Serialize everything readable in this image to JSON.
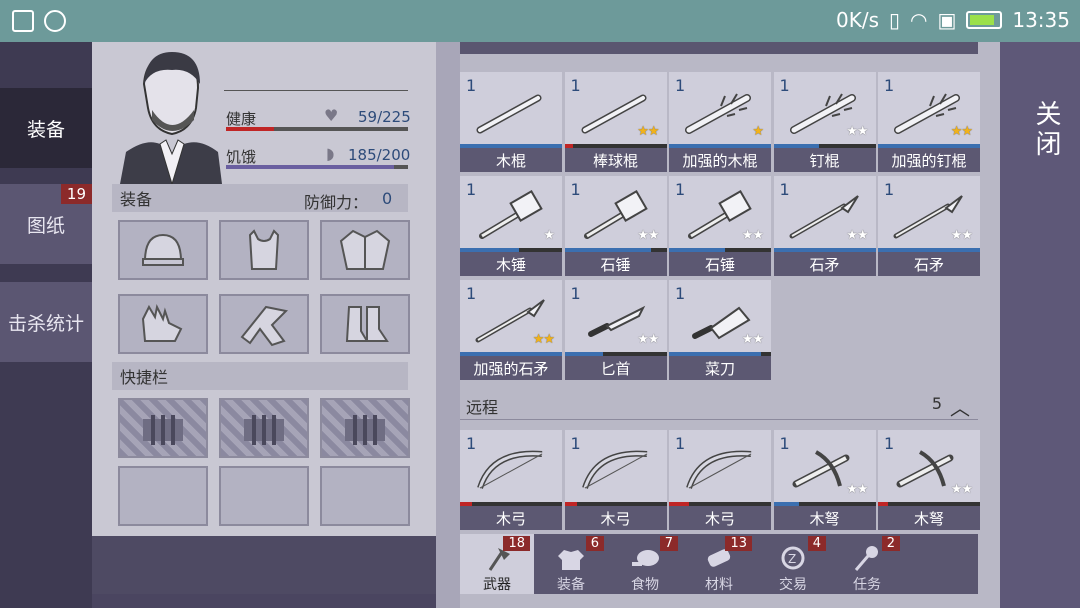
{
  "status_bar": {
    "speed": "0K/s",
    "time": "13:35"
  },
  "left_tabs": [
    {
      "label": "装备",
      "active": true
    },
    {
      "label": "图纸",
      "badge": "19"
    },
    {
      "label": "击杀统计"
    }
  ],
  "character": {
    "health_label": "健康",
    "health_value": "59/225",
    "hunger_label": "饥饿",
    "hunger_value": "185/200",
    "equip_label": "装备",
    "defense_label": "防御力：",
    "defense_value": "0",
    "hotbar_label": "快捷栏",
    "equip_slots": [
      "hat-icon",
      "vest-icon",
      "jacket-icon",
      "gloves-icon",
      "pants-icon",
      "boots-icon"
    ]
  },
  "inventory": {
    "melee": [
      {
        "qty": "1",
        "name": "木棍",
        "stars": "",
        "star_color": "none",
        "bar_color": "#3b6fb0",
        "bar_pct": 100
      },
      {
        "qty": "1",
        "name": "棒球棍",
        "stars": "★★",
        "star_color": "gold",
        "bar_color": "#c02525",
        "bar_pct": 8
      },
      {
        "qty": "1",
        "name": "加强的木棍",
        "stars": "★",
        "star_color": "gold",
        "bar_color": "#3b6fb0",
        "bar_pct": 100
      },
      {
        "qty": "1",
        "name": "钉棍",
        "stars": "★★",
        "star_color": "white",
        "bar_color": "#3b6fb0",
        "bar_pct": 45
      },
      {
        "qty": "1",
        "name": "加强的钉棍",
        "stars": "★★",
        "star_color": "gold",
        "bar_color": "#3b6fb0",
        "bar_pct": 100
      },
      {
        "qty": "1",
        "name": "木锤",
        "stars": "★",
        "star_color": "white",
        "bar_color": "#3b6fb0",
        "bar_pct": 58
      },
      {
        "qty": "1",
        "name": "石锤",
        "stars": "★★",
        "star_color": "white",
        "bar_color": "#3b6fb0",
        "bar_pct": 85
      },
      {
        "qty": "1",
        "name": "石锤",
        "stars": "★★",
        "star_color": "white",
        "bar_color": "#3b6fb0",
        "bar_pct": 55
      },
      {
        "qty": "1",
        "name": "石矛",
        "stars": "★★",
        "star_color": "white",
        "bar_color": "#3b6fb0",
        "bar_pct": 100
      },
      {
        "qty": "1",
        "name": "石矛",
        "stars": "★★",
        "star_color": "white",
        "bar_color": "#3b6fb0",
        "bar_pct": 100
      },
      {
        "qty": "1",
        "name": "加强的石矛",
        "stars": "★★",
        "star_color": "gold",
        "bar_color": "#3b6fb0",
        "bar_pct": 100
      },
      {
        "qty": "1",
        "name": "匕首",
        "stars": "★★",
        "star_color": "white",
        "bar_color": "#3b6fb0",
        "bar_pct": 38
      },
      {
        "qty": "1",
        "name": "菜刀",
        "stars": "★★",
        "star_color": "white",
        "bar_color": "#3b6fb0",
        "bar_pct": 90
      }
    ],
    "ranged_title": "远程",
    "ranged_count": "5",
    "ranged": [
      {
        "qty": "1",
        "name": "木弓",
        "stars": "",
        "star_color": "none",
        "bar_color": "#c02525",
        "bar_pct": 12
      },
      {
        "qty": "1",
        "name": "木弓",
        "stars": "",
        "star_color": "none",
        "bar_color": "#c02525",
        "bar_pct": 12
      },
      {
        "qty": "1",
        "name": "木弓",
        "stars": "",
        "star_color": "none",
        "bar_color": "#c02525",
        "bar_pct": 20
      },
      {
        "qty": "1",
        "name": "木弩",
        "stars": "★★",
        "star_color": "white",
        "bar_color": "#3b6fb0",
        "bar_pct": 25
      },
      {
        "qty": "1",
        "name": "木弩",
        "stars": "★★",
        "star_color": "white",
        "bar_color": "#c02525",
        "bar_pct": 10
      }
    ]
  },
  "categories": [
    {
      "label": "武器",
      "badge": "18",
      "icon": "axe-icon",
      "active": true
    },
    {
      "label": "装备",
      "badge": "6",
      "icon": "shirt-icon"
    },
    {
      "label": "食物",
      "badge": "7",
      "icon": "meat-icon"
    },
    {
      "label": "材料",
      "badge": "13",
      "icon": "log-icon"
    },
    {
      "label": "交易",
      "badge": "4",
      "icon": "coin-icon"
    },
    {
      "label": "任务",
      "badge": "2",
      "icon": "key-icon"
    }
  ],
  "close_label": "关闭",
  "colors": {
    "health": "#c02525",
    "hunger": "#6a5fa0",
    "gold_star": "#f1b21a"
  }
}
